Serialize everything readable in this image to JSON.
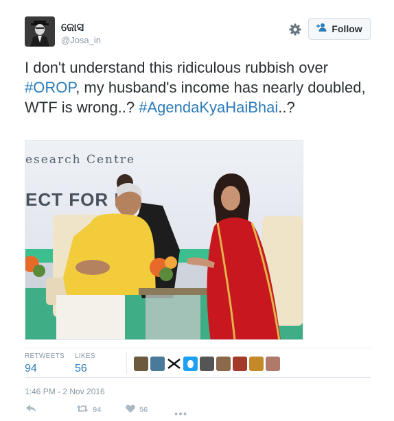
{
  "tweet": {
    "display_name": "ଜୋସ",
    "handle": "@Josa_in",
    "text_parts": [
      {
        "text": "I don't understand this ridiculous rubbish over "
      },
      {
        "text": "#OROP",
        "hashtag": true
      },
      {
        "text": ", my husband's income has nearly doubled, WTF is wrong..? "
      },
      {
        "text": "#AgendaKyaHaiBhai",
        "hashtag": true
      },
      {
        "text": "..?"
      }
    ],
    "photo_sign_line1": "esearch Centre",
    "photo_sign_line2": "ECT FOR  E",
    "timestamp": "1:46 PM - 2 Nov 2016"
  },
  "follow_button": {
    "label": "Follow"
  },
  "stats": {
    "retweets_label": "RETWEETS",
    "retweets_value": "94",
    "likes_label": "LIKES",
    "likes_value": "56"
  },
  "actions": {
    "retweet_count": "94",
    "like_count": "56"
  },
  "icons": {
    "settings": "gear-icon",
    "follow": "person-add-icon",
    "reply": "reply-icon",
    "retweet": "retweet-icon",
    "like": "heart-icon",
    "more": "more-icon"
  },
  "colors": {
    "hashtag": "#2b7bb9",
    "muted": "#8899a6",
    "text": "#292f33",
    "stat_value": "#2b7bb9"
  }
}
